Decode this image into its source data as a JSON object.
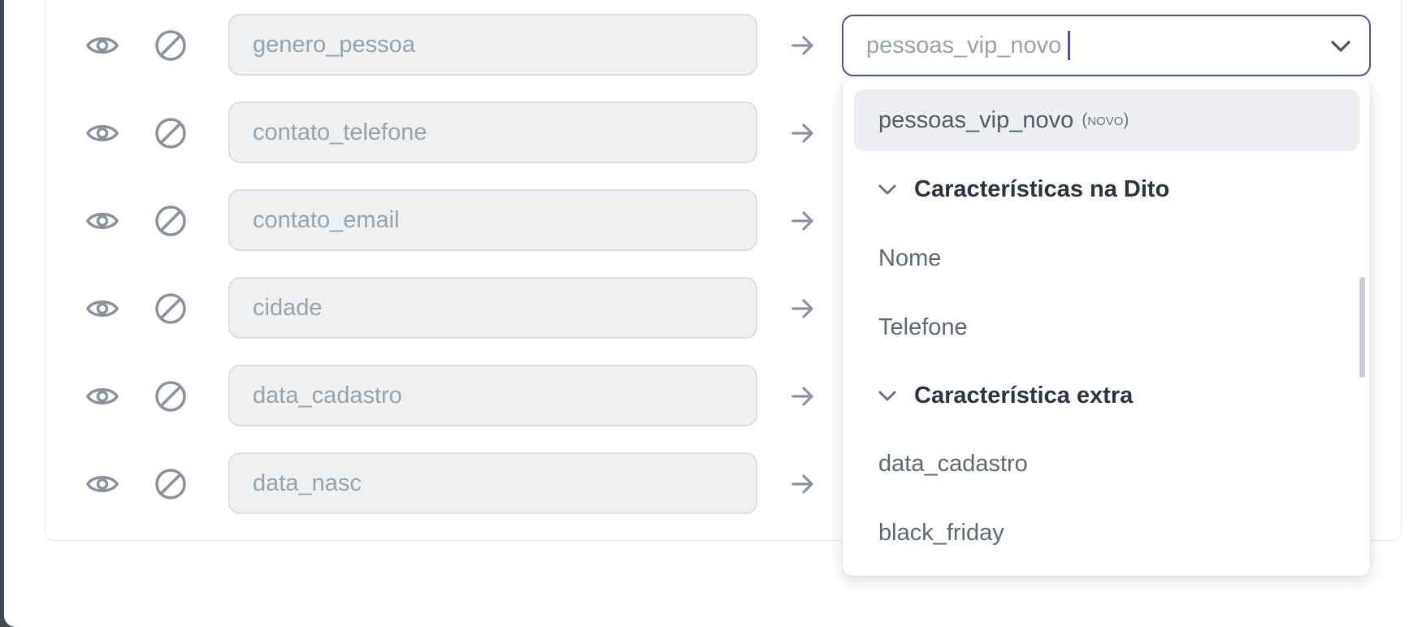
{
  "rows": [
    {
      "field": "genero_pessoa"
    },
    {
      "field": "contato_telefone"
    },
    {
      "field": "contato_email"
    },
    {
      "field": "cidade"
    },
    {
      "field": "data_cadastro"
    },
    {
      "field": "data_nasc"
    }
  ],
  "select": {
    "value": "pessoas_vip_novo"
  },
  "dropdown": {
    "selected_label": "pessoas_vip_novo",
    "selected_tag": "(novo)",
    "group1_label": "Características na Dito",
    "group1_items": [
      "Nome",
      "Telefone"
    ],
    "group2_label": "Característica extra",
    "group2_items": [
      "data_cadastro",
      "black_friday"
    ]
  },
  "colors": {
    "accent": "#4e5590",
    "icon": "#8a909c",
    "field_bg": "#eff0f2"
  }
}
